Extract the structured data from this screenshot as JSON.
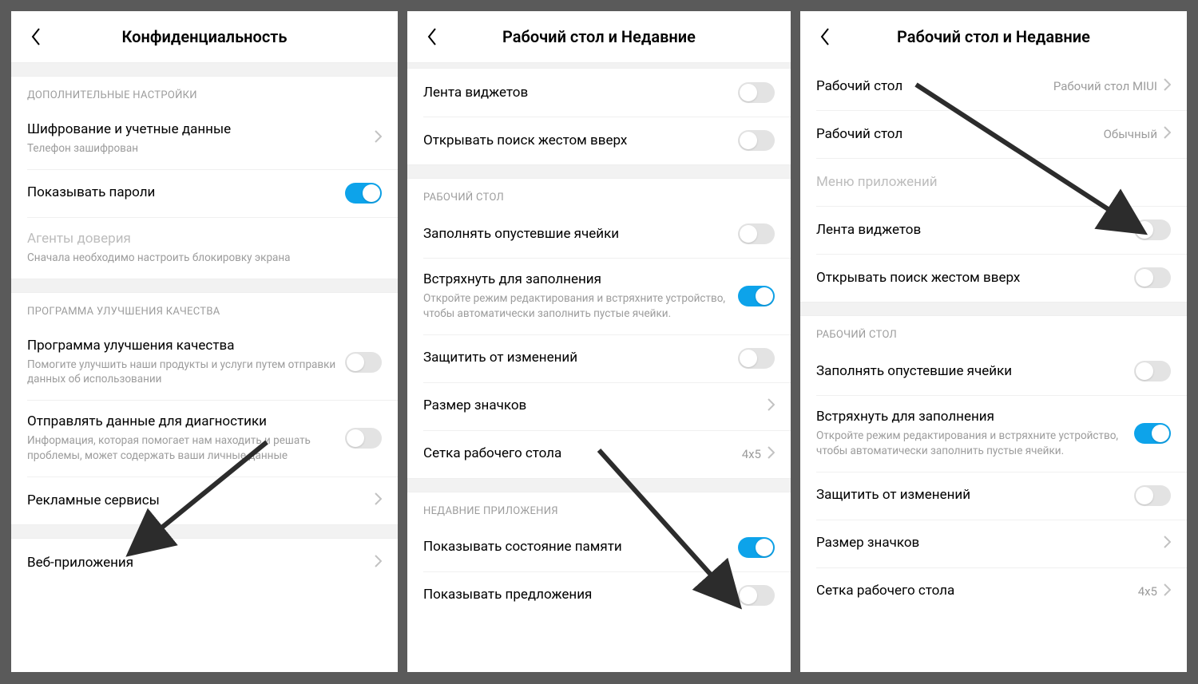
{
  "p1": {
    "title": "Конфиденциальность",
    "sections": [
      {
        "header": "ДОПОЛНИТЕЛЬНЫЕ НАСТРОЙКИ",
        "rows": [
          {
            "label": "Шифрование и учетные данные",
            "sub": "Телефон зашифрован",
            "type": "nav"
          },
          {
            "label": "Показывать пароли",
            "type": "toggle",
            "on": true
          },
          {
            "label": "Агенты доверия",
            "sub": "Сначала необходимо настроить блокировку экрана",
            "type": "disabled"
          }
        ]
      },
      {
        "header": "ПРОГРАММА УЛУЧШЕНИЯ КАЧЕСТВА",
        "rows": [
          {
            "label": "Программа улучшения качества",
            "sub": "Помогите улучшить наши продукты и услуги путем отправки данных об использовании",
            "type": "toggle",
            "on": false
          },
          {
            "label": "Отправлять данные для диагностики",
            "sub": "Информация, которая помогает нам находить и решать проблемы, может содержать ваши личные данные",
            "type": "toggle",
            "on": false
          },
          {
            "label": "Рекламные сервисы",
            "type": "nav"
          }
        ]
      },
      {
        "rows": [
          {
            "label": "Веб-приложения",
            "type": "nav"
          }
        ]
      }
    ]
  },
  "p2": {
    "title": "Рабочий стол и Недавние",
    "rows_top": [
      {
        "label": "Лента виджетов",
        "type": "toggle",
        "on": false
      },
      {
        "label": "Открывать поиск жестом вверх",
        "type": "toggle",
        "on": false
      }
    ],
    "sections": [
      {
        "header": "РАБОЧИЙ СТОЛ",
        "rows": [
          {
            "label": "Заполнять опустевшие ячейки",
            "type": "toggle",
            "on": false
          },
          {
            "label": "Встряхнуть для заполнения",
            "sub": "Откройте режим редактирования и встряхните устройство, чтобы автоматически заполнить пустые ячейки.",
            "type": "toggle",
            "on": true
          },
          {
            "label": "Защитить от изменений",
            "type": "toggle",
            "on": false
          },
          {
            "label": "Размер значков",
            "type": "nav"
          },
          {
            "label": "Сетка рабочего стола",
            "type": "nav",
            "value": "4x5"
          }
        ]
      },
      {
        "header": "НЕДАВНИЕ ПРИЛОЖЕНИЯ",
        "rows": [
          {
            "label": "Показывать состояние памяти",
            "type": "toggle",
            "on": true
          },
          {
            "label": "Показывать предложения",
            "type": "toggle",
            "on": false
          }
        ]
      }
    ]
  },
  "p3": {
    "title": "Рабочий стол и Недавние",
    "rows_top": [
      {
        "label": "Рабочий стол",
        "type": "nav",
        "value": "Рабочий стол MIUI"
      },
      {
        "label": "Рабочий стол",
        "type": "nav",
        "value": "Обычный"
      },
      {
        "label": "Меню приложений",
        "type": "disabled"
      },
      {
        "label": "Лента виджетов",
        "type": "toggle",
        "on": false
      },
      {
        "label": "Открывать поиск жестом вверх",
        "type": "toggle",
        "on": false
      }
    ],
    "sections": [
      {
        "header": "РАБОЧИЙ СТОЛ",
        "rows": [
          {
            "label": "Заполнять опустевшие ячейки",
            "type": "toggle",
            "on": false
          },
          {
            "label": "Встряхнуть для заполнения",
            "sub": "Откройте режим редактирования и встряхните устройство, чтобы автоматически заполнить пустые ячейки.",
            "type": "toggle",
            "on": true
          },
          {
            "label": "Защитить от изменений",
            "type": "toggle",
            "on": false
          },
          {
            "label": "Размер значков",
            "type": "nav"
          },
          {
            "label": "Сетка рабочего стола",
            "type": "nav",
            "value": "4x5"
          }
        ]
      }
    ]
  },
  "annotations": {
    "arrow1": "pointer-arrow",
    "arrow2": "pointer-arrow",
    "arrow3": "pointer-arrow"
  }
}
